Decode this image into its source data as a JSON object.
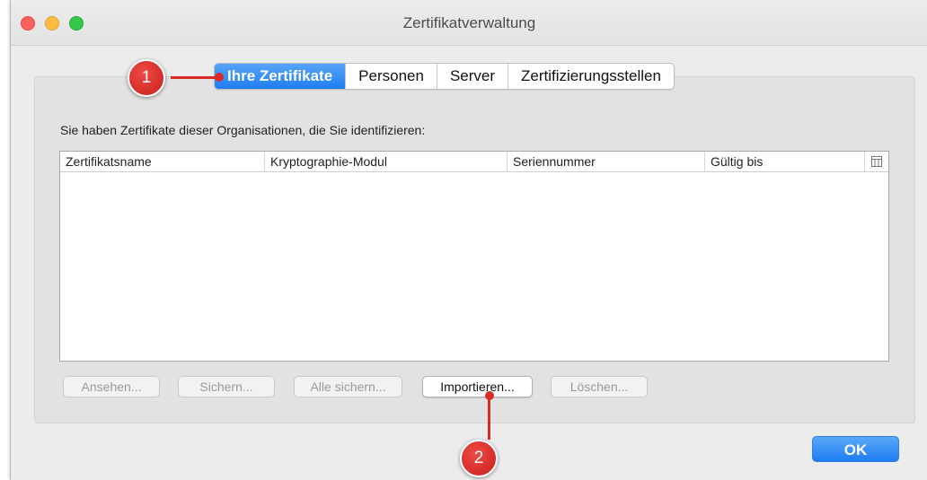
{
  "window": {
    "title": "Zertifikatverwaltung"
  },
  "tabs": [
    {
      "label": "Ihre Zertifikate",
      "active": true
    },
    {
      "label": "Personen",
      "active": false
    },
    {
      "label": "Server",
      "active": false
    },
    {
      "label": "Zertifizierungsstellen",
      "active": false
    }
  ],
  "description": "Sie haben Zertifikate dieser Organisationen, die Sie identifizieren:",
  "table": {
    "columns": [
      "Zertifikatsname",
      "Kryptographie-Modul",
      "Seriennummer",
      "Gültig bis"
    ],
    "rows": []
  },
  "buttons": {
    "view": "Ansehen...",
    "backup": "Sichern...",
    "backup_all": "Alle sichern...",
    "import": "Importieren...",
    "delete": "Löschen...",
    "ok": "OK"
  },
  "annotations": {
    "marker1": "1",
    "marker2": "2"
  },
  "colors": {
    "accent": "#1f7df2",
    "annotation": "#d92b26"
  }
}
